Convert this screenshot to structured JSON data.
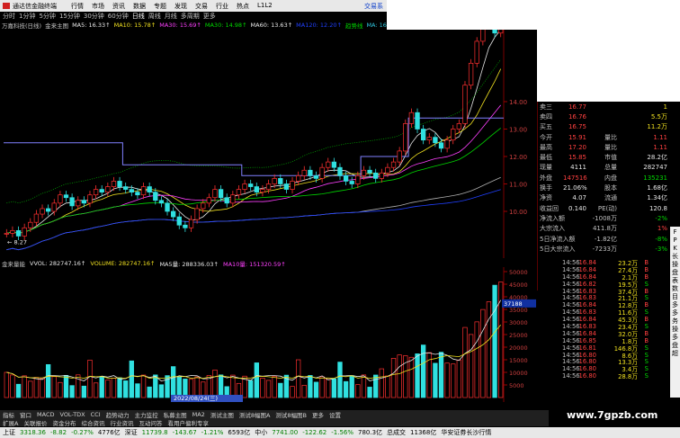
{
  "titlebar": {
    "app_name": "通达信金融终端",
    "menu": [
      "行情",
      "市场",
      "资讯",
      "数据",
      "专题",
      "发现",
      "交易",
      "行业",
      "热点",
      "L1L2"
    ],
    "trade_label": "交易系"
  },
  "periods": [
    "分时",
    "1分钟",
    "5分钟",
    "15分钟",
    "30分钟",
    "60分钟",
    "日线",
    "周线",
    "月线",
    "多周期",
    "更多"
  ],
  "active_period": "日线",
  "ma_bar": [
    {
      "text": "万嘉科技(日线)",
      "color": "#c0c0c0"
    },
    {
      "text": "金来主图",
      "color": "#c0c0c0"
    },
    {
      "text": "MA5: 16.33↑",
      "color": "#e8e8e8"
    },
    {
      "text": "MA10: 15.78↑",
      "color": "#f0e020"
    },
    {
      "text": "MA30: 15.69↑",
      "color": "#ff40ff"
    },
    {
      "text": "MA30: 14.98↑",
      "color": "#00d800"
    },
    {
      "text": "MA60: 13.63↑",
      "color": "#e8e8e8"
    },
    {
      "text": "MA120: 12.20↑",
      "color": "#2040ff"
    },
    {
      "text": "趋势线",
      "color": "#00d800"
    },
    {
      "text": "MA: 16.33↑",
      "color": "#30c8e0"
    },
    {
      "text": "域线: 18.52",
      "color": "#f0e020"
    }
  ],
  "main_axis": [
    "14.00",
    "13.00",
    "12.00",
    "11.00",
    "10.00"
  ],
  "low_label": "← 8.27",
  "price_panel": {
    "rows": [
      {
        "c1": "卖三",
        "c2": "16.77",
        "c2c": "red",
        "c3": "",
        "c4": "1",
        "c4c": "yellow"
      },
      {
        "c1": "卖四",
        "c2": "16.76",
        "c2c": "red",
        "c3": "",
        "c4": "5.5万",
        "c4c": "yellow"
      },
      {
        "c1": "买五",
        "c2": "16.75",
        "c2c": "red",
        "c3": "",
        "c4": "11.2万",
        "c4c": "yellow"
      },
      {
        "c1": "今开",
        "c2": "15.91",
        "c2c": "red",
        "c3": "量比",
        "c4": "1.11",
        "c4c": "red"
      },
      {
        "c1": "最高",
        "c2": "17.20",
        "c2c": "red",
        "c3": "量比",
        "c4": "1.11",
        "c4c": "red"
      },
      {
        "c1": "最低",
        "c2": "15.85",
        "c2c": "red",
        "c3": "市值",
        "c4": "28.2亿",
        "c4c": "white"
      },
      {
        "c1": "现量",
        "c2": "4111",
        "c2c": "white",
        "c3": "总量",
        "c4": "282747",
        "c4c": "white"
      },
      {
        "c1": "外盘",
        "c2": "147516",
        "c2c": "red",
        "c3": "内盘",
        "c4": "135231",
        "c4c": "green"
      },
      {
        "c1": "换手",
        "c2": "21.06%",
        "c2c": "white",
        "c3": "股本",
        "c4": "1.68亿",
        "c4c": "white"
      },
      {
        "c1": "净资",
        "c2": "4.07",
        "c2c": "white",
        "c3": "流通",
        "c4": "1.34亿",
        "c4c": "white"
      },
      {
        "c1": "收益回",
        "c2": "0.140",
        "c2c": "white",
        "c3": "PE(动)",
        "c4": "120.8",
        "c4c": "white"
      },
      {
        "c1": "净流入额",
        "c2": "",
        "c2c": "white",
        "c3": "-1008万",
        "c4": "-2%",
        "c4c": "green"
      },
      {
        "c1": "大宗流入",
        "c2": "",
        "c2c": "white",
        "c3": "411.8万",
        "c4": "1%",
        "c4c": "red"
      },
      {
        "c1": "5日净流入额",
        "c2": "",
        "c2c": "white",
        "c3": "-1.82亿",
        "c4": "-8%",
        "c4c": "green"
      },
      {
        "c1": "5日大宗流入",
        "c2": "",
        "c2c": "white",
        "c3": "-7233万",
        "c4": "-3%",
        "c4c": "green"
      }
    ]
  },
  "ticks": [
    {
      "t": "14:56",
      "p": "16.84",
      "v": "23.2万",
      "d": "B"
    },
    {
      "t": "14:56",
      "p": "16.84",
      "v": "27.4万",
      "d": "B"
    },
    {
      "t": "14:56",
      "p": "16.84",
      "v": "2.1万",
      "d": "B"
    },
    {
      "t": "14:56",
      "p": "16.82",
      "v": "19.5万",
      "d": "S"
    },
    {
      "t": "14:56",
      "p": "16.83",
      "v": "37.4万",
      "d": "B"
    },
    {
      "t": "14:56",
      "p": "16.83",
      "v": "21.1万",
      "d": "S"
    },
    {
      "t": "14:56",
      "p": "16.84",
      "v": "12.8万",
      "d": "B"
    },
    {
      "t": "14:56",
      "p": "16.83",
      "v": "11.6万",
      "d": "S"
    },
    {
      "t": "14:56",
      "p": "16.84",
      "v": "45.3万",
      "d": "B"
    },
    {
      "t": "14:56",
      "p": "16.83",
      "v": "23.4万",
      "d": "S"
    },
    {
      "t": "14:56",
      "p": "16.84",
      "v": "32.0万",
      "d": "B"
    },
    {
      "t": "14:56",
      "p": "16.85",
      "v": "1.8万",
      "d": "B"
    },
    {
      "t": "14:56",
      "p": "16.81",
      "v": "146.8万",
      "d": "S"
    },
    {
      "t": "14:56",
      "p": "16.80",
      "v": "8.6万",
      "d": "S"
    },
    {
      "t": "14:56",
      "p": "16.80",
      "v": "13.3万",
      "d": "S"
    },
    {
      "t": "14:56",
      "p": "16.80",
      "v": "3.4万",
      "d": "S"
    },
    {
      "t": "14:56",
      "p": "16.80",
      "v": "28.8万",
      "d": "S"
    }
  ],
  "sidebar": [
    "F",
    "P",
    "K",
    "长",
    "操",
    "盘",
    "表",
    "数",
    "目",
    "多",
    "多",
    "务",
    "操",
    "多",
    "盘",
    "超"
  ],
  "vol_header": [
    {
      "text": "金来量能",
      "color": "#c0c0c0"
    },
    {
      "text": "VVOL: 282747.16↑",
      "color": "#e8e8e8"
    },
    {
      "text": "VOLUME: 282747.16↑",
      "color": "#f0e020"
    },
    {
      "text": "MA5量: 288336.03↑",
      "color": "#e8e8e8"
    },
    {
      "text": "MA10量: 151320.59↑",
      "color": "#ff40ff"
    }
  ],
  "vol_axis": [
    "50000",
    "45000",
    "40000",
    "35000",
    "30000",
    "25000",
    "20000",
    "15000",
    "10000",
    "5000"
  ],
  "vol_current": "37188",
  "date_label": "2022/08/24(三)",
  "bottom_tabs": [
    "指标",
    "窗口",
    "MACD",
    "VOL-TDX",
    "CCI",
    "趋势动力",
    "主力监控",
    "私募主图",
    "MA2",
    "测试主图",
    "测试8幅图A",
    "测试8幅图B",
    "更多",
    "设置"
  ],
  "bottom_tabs2": [
    "扩展A",
    "关联报价",
    "资金分布",
    "综合资讯",
    "行业资讯",
    "互动问答",
    "看用户偏利专享"
  ],
  "status": [
    {
      "text": "上证",
      "color": "#000"
    },
    {
      "text": "3318.36",
      "color": "#008000"
    },
    {
      "text": "-8.82",
      "color": "#008000"
    },
    {
      "text": "-0.27%",
      "color": "#008000"
    },
    {
      "text": "4776亿",
      "color": "#000"
    },
    {
      "text": "深证",
      "color": "#000"
    },
    {
      "text": "11739.8",
      "color": "#008000"
    },
    {
      "text": "-143.67",
      "color": "#008000"
    },
    {
      "text": "-1.21%",
      "color": "#008000"
    },
    {
      "text": "6593亿",
      "color": "#000"
    },
    {
      "text": "中小",
      "color": "#000"
    },
    {
      "text": "7741.00",
      "color": "#008000"
    },
    {
      "text": "-122.62",
      "color": "#008000"
    },
    {
      "text": "-1.56%",
      "color": "#008000"
    },
    {
      "text": "780.3亿",
      "color": "#000"
    },
    {
      "text": "总成交",
      "color": "#000"
    },
    {
      "text": "11368亿",
      "color": "#000"
    },
    {
      "text": "华安证券长沙行情",
      "color": "#000"
    }
  ],
  "watermark": "www.7gpzb.com",
  "chart_data": {
    "type": "candlestick",
    "price_axis": [
      10,
      14
    ],
    "closes": [
      9.2,
      9.3,
      9.1,
      9.4,
      9.6,
      9.9,
      10.1,
      10.0,
      10.3,
      10.6,
      10.5,
      10.2,
      10.4,
      10.3,
      10.6,
      10.8,
      10.7,
      10.9,
      11.1,
      10.9,
      10.8,
      10.7,
      10.6,
      10.9,
      10.7,
      10.4,
      10.3,
      10.0,
      9.8,
      9.5,
      9.4,
      9.7,
      10.1,
      10.3,
      10.5,
      10.8,
      10.5,
      10.3,
      10.6,
      10.8,
      11.0,
      10.9,
      10.7,
      10.8,
      11.0,
      11.2,
      11.0,
      10.8,
      11.1,
      11.3,
      11.5,
      11.3,
      11.2,
      11.6,
      11.8,
      11.6,
      11.3,
      11.1,
      11.0,
      11.3,
      11.5,
      11.4,
      11.2,
      11.4,
      11.6,
      11.8,
      12.2,
      13.2,
      13.6,
      13.0,
      12.6,
      12.7,
      12.5,
      12.3,
      12.6,
      13.0,
      13.2,
      14.6,
      15.4,
      16.2,
      16.8,
      16.84,
      16.5,
      16.8
    ]
  }
}
